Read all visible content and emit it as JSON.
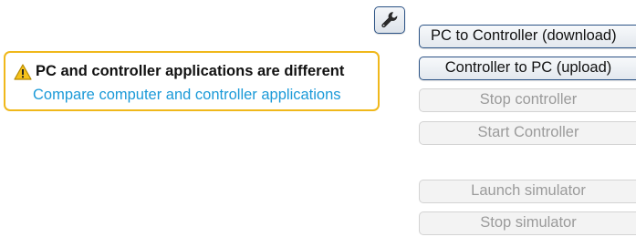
{
  "toolbar": {
    "settings_icon": "wrench-icon"
  },
  "status": {
    "icon": "warning-icon",
    "message": "PC and controller applications are different",
    "link": "Compare computer and controller applications",
    "border_color": "#f0b81b",
    "link_color": "#1b9ad8"
  },
  "actions": {
    "download": "PC to Controller (download)",
    "upload": "Controller to PC (upload)",
    "stop_controller": "Stop controller",
    "start_controller": "Start Controller",
    "launch_simulator": "Launch simulator",
    "stop_simulator": "Stop simulator"
  },
  "colors": {
    "button_border": "#2b5285",
    "disabled_text": "#9b9b9b"
  }
}
